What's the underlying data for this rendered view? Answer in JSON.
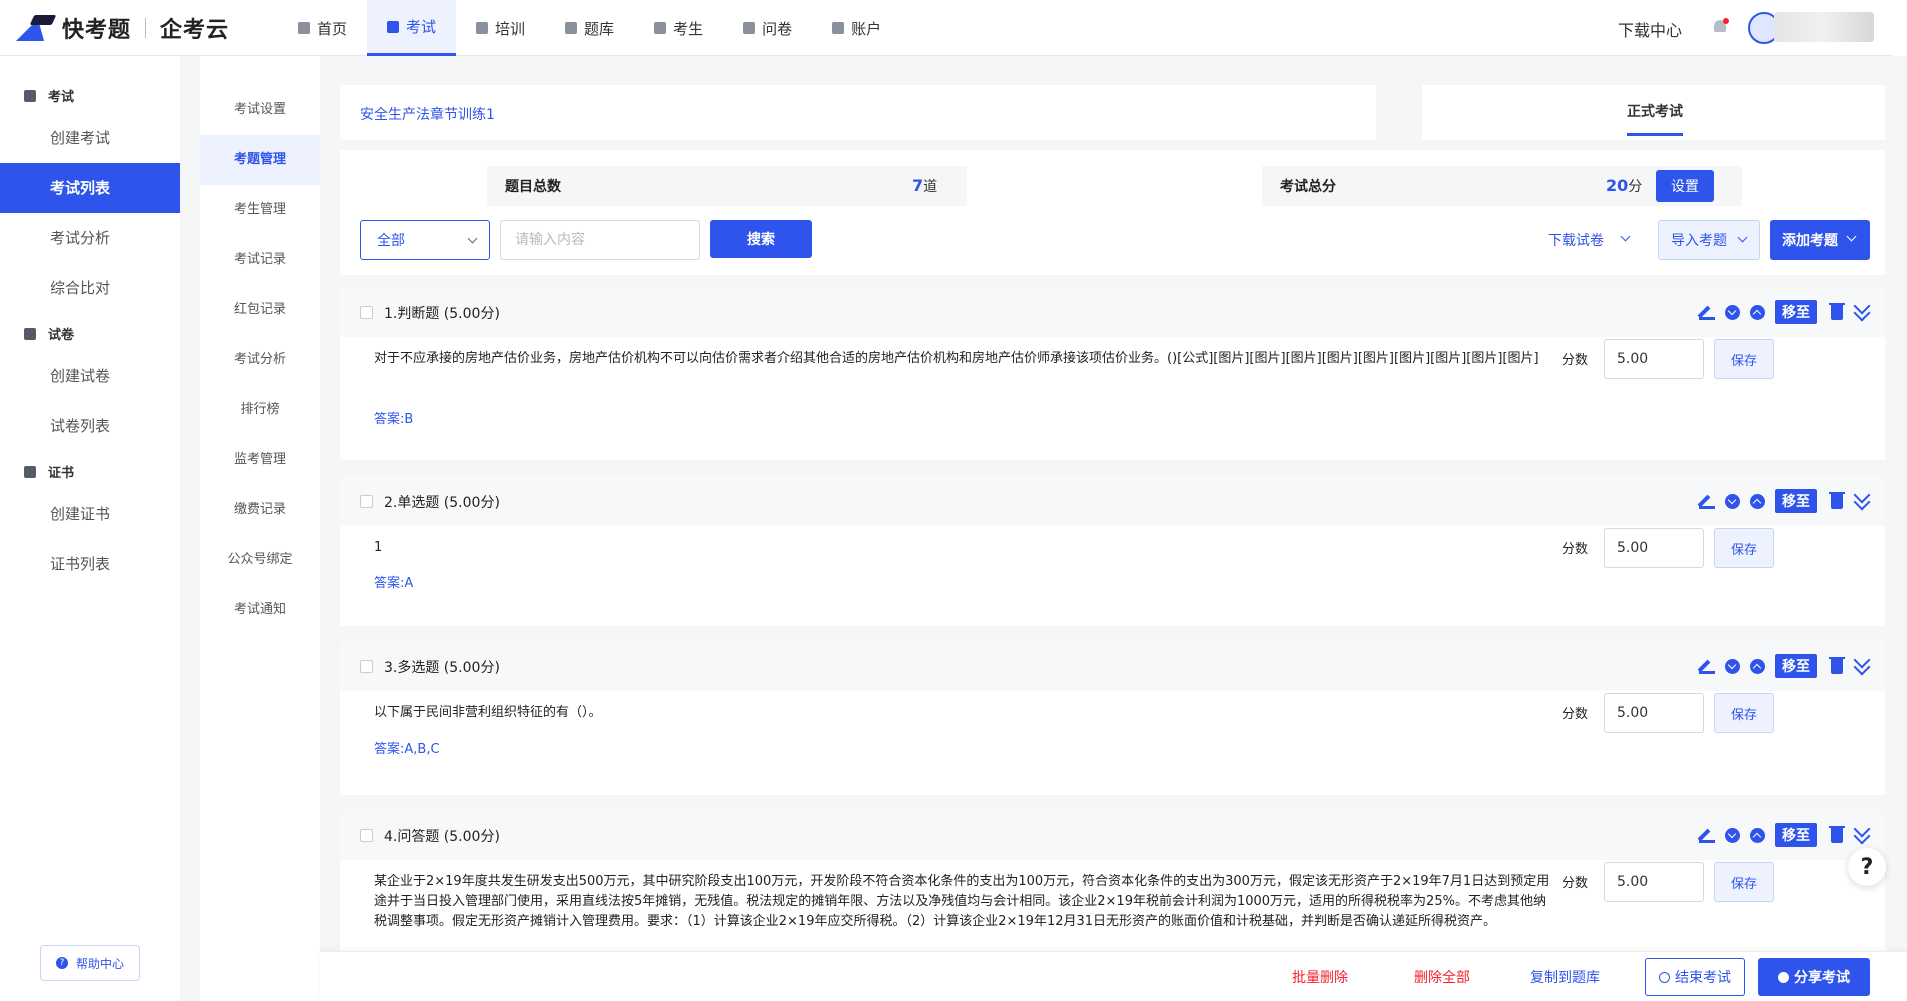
{
  "brand": {
    "name": "快考题",
    "sub": "企考云"
  },
  "nav": [
    {
      "label": "首页",
      "active": false
    },
    {
      "label": "考试",
      "active": true
    },
    {
      "label": "培训",
      "active": false
    },
    {
      "label": "题库",
      "active": false
    },
    {
      "label": "考生",
      "active": false
    },
    {
      "label": "问卷",
      "active": false
    },
    {
      "label": "账户",
      "active": false
    }
  ],
  "header": {
    "download_center": "下载中心"
  },
  "sidebar": {
    "groups": [
      {
        "label": "考试",
        "items": [
          "创建考试",
          "考试列表",
          "考试分析",
          "综合比对"
        ]
      },
      {
        "label": "试卷",
        "items": [
          "创建试卷",
          "试卷列表"
        ]
      },
      {
        "label": "证书",
        "items": [
          "创建证书",
          "证书列表"
        ]
      }
    ],
    "active_item": "考试列表",
    "help": "帮助中心"
  },
  "subnav": {
    "items": [
      "考试设置",
      "考题管理",
      "考生管理",
      "考试记录",
      "红包记录",
      "考试分析",
      "排行榜",
      "监考管理",
      "缴费记录",
      "公众号绑定",
      "考试通知"
    ],
    "active": "考题管理"
  },
  "exam": {
    "title": "安全生产法章节训练1",
    "mode_tab": "正式考试",
    "total_questions_label": "题目总数",
    "total_questions_value": "7",
    "total_questions_unit": "道",
    "total_score_label": "考试总分",
    "total_score_value": "20",
    "total_score_unit": "分",
    "settings_button": "设置"
  },
  "toolbar": {
    "filter_selected": "全部",
    "search_placeholder": "请输入内容",
    "search_button": "搜索",
    "download_paper": "下载试卷",
    "import_questions": "导入考题",
    "add_question": "添加考题"
  },
  "questions": [
    {
      "header": "1.判断题 (5.00分)",
      "text": "对于不应承接的房地产估价业务，房地产估价机构不可以向估价需求者介绍其他合适的房地产估价机构和房地产估价师承接该项估价业务。()[公式][图片][图片][图片][图片][图片][图片][图片][图片][图片]",
      "answer": "答案:B",
      "score_label": "分数",
      "score": "5.00",
      "save": "保存",
      "move_to": "移至"
    },
    {
      "header": "2.单选题 (5.00分)",
      "text": "1",
      "answer": "答案:A",
      "score_label": "分数",
      "score": "5.00",
      "save": "保存",
      "move_to": "移至"
    },
    {
      "header": "3.多选题 (5.00分)",
      "text": "以下属于民间非营利组织特征的有（）。",
      "answer": "答案:A,B,C",
      "score_label": "分数",
      "score": "5.00",
      "save": "保存",
      "move_to": "移至"
    },
    {
      "header": "4.问答题 (5.00分)",
      "text": "某企业于2×19年度共发生研发支出500万元，其中研究阶段支出100万元，开发阶段不符合资本化条件的支出为100万元，符合资本化条件的支出为300万元，假定该无形资产于2×19年7月1日达到预定用途并于当日投入管理部门使用，采用直线法按5年摊销，无残值。税法规定的摊销年限、方法以及净残值均与会计相同。该企业2×19年税前会计利润为1000万元，适用的所得税税率为25%。不考虑其他纳税调整事项。假定无形资产摊销计入管理费用。要求：（1）计算该企业2×19年应交所得税。（2）计算该企业2×19年12月31日无形资产的账面价值和计税基础，并判断是否确认递延所得税资产。",
      "answer": "",
      "score_label": "分数",
      "score": "5.00",
      "save": "保存",
      "move_to": "移至"
    }
  ],
  "bottom": {
    "batch_delete": "批量删除",
    "delete_all": "删除全部",
    "copy_to_bank": "复制到题库",
    "end_exam": "结束考试",
    "share_exam": "分享考试"
  },
  "help_float": "?",
  "colors": {
    "primary": "#2f54eb",
    "danger": "#f5222d",
    "bg": "#f5f6f8"
  }
}
